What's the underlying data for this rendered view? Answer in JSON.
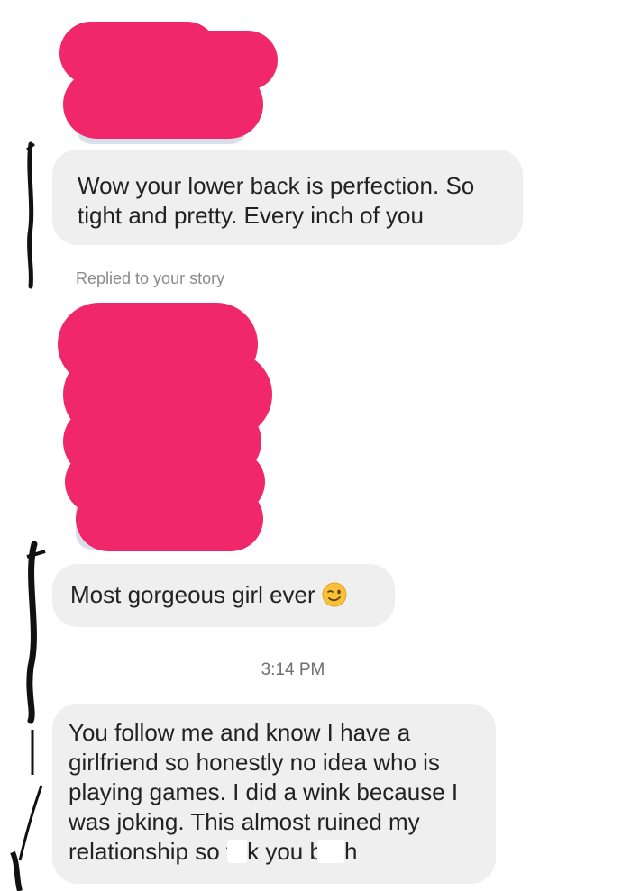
{
  "messages": {
    "first": "Wow your lower back is perfection. So tight and pretty. Every inch of you",
    "story_label": "Replied to your story",
    "second": "Most gorgeous girl ever",
    "timestamp": "3:14 PM",
    "third_line_1": "You follow me and know I have a",
    "third_line_2": "girlfriend so honestly no idea who is",
    "third_line_3": "playing games. I did a wink because I",
    "third_line_4": "was joking. This almost ruined my",
    "third_part_a": "relationship so f",
    "third_part_b": "k you b",
    "third_part_c": "h"
  },
  "icons": {
    "wink": "winking-face-emoji"
  },
  "colors": {
    "redaction": "#f0276a",
    "bubble": "#efefef",
    "story_label": "#8a8a8a"
  }
}
